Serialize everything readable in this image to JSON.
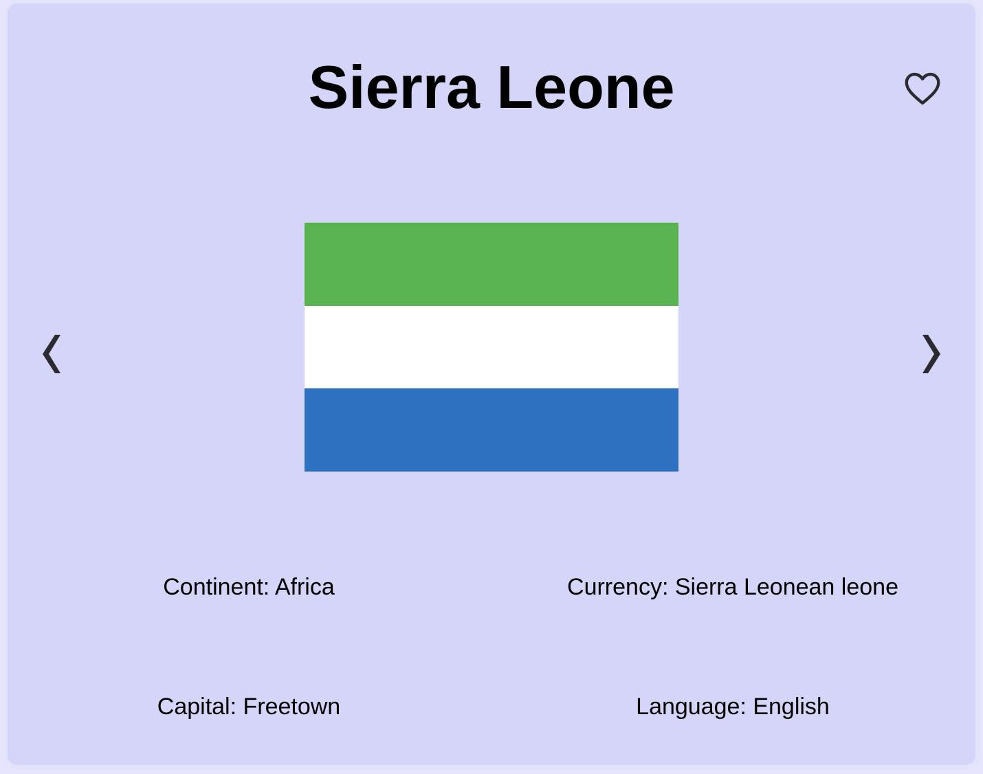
{
  "country": {
    "name": "Sierra Leone"
  },
  "flag": {
    "stripes": [
      "#57b24f",
      "#ffffff",
      "#2f71c1"
    ]
  },
  "nav": {
    "prev_icon": "chevron-left-icon",
    "next_icon": "chevron-right-icon"
  },
  "favorite": {
    "icon": "heart-outline-icon"
  },
  "details": {
    "continent": "Continent: Africa",
    "currency": "Currency: Sierra Leonean leone",
    "capital": "Capital: Freetown",
    "language": "Language: English"
  },
  "colors": {
    "page_background": "#e3e4fb",
    "card_background": "#d4d5f8",
    "icon_color": "#2a2a30"
  }
}
